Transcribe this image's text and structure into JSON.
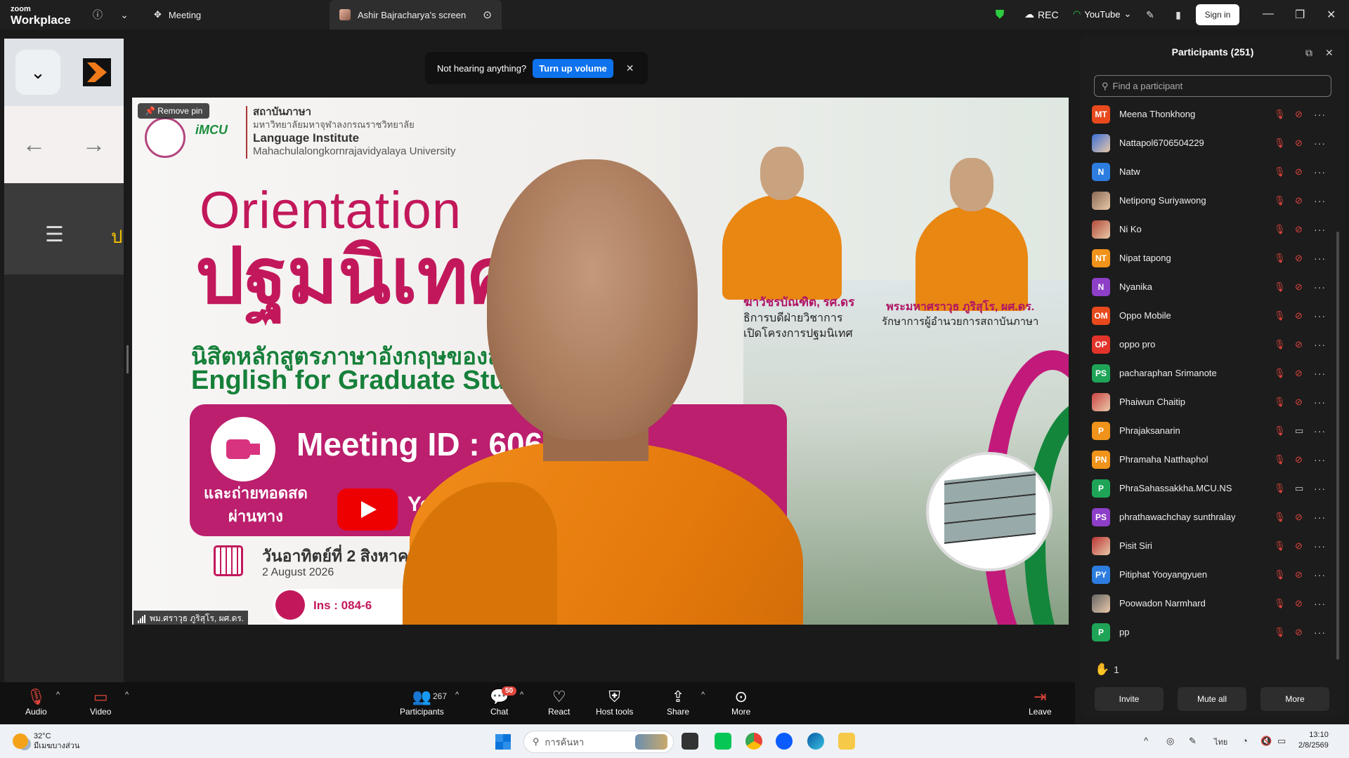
{
  "app": {
    "brand_small": "zoom",
    "brand_big": "Workplace"
  },
  "tabs": [
    {
      "label": "Meeting"
    },
    {
      "label": "Ashir Bajracharya's screen"
    }
  ],
  "titlebar": {
    "rec": "REC",
    "youtube": "YouTube",
    "sign_in": "Sign in"
  },
  "notification": {
    "text": "Not hearing anything?",
    "button": "Turn up volume"
  },
  "stage": {
    "remove_pin": "Remove pin",
    "nametag": "พม.ศราวุธ ภูริสุโร, ผศ.ดร.",
    "slide": {
      "inst_th1": "สถาบันภาษา",
      "inst_th2": "มหาวิทยาลัยมหาจุฬาลงกรณราชวิทยาลัย",
      "inst_en1": "Language Institute",
      "inst_en2": "Mahachulalongkornrajavidyalaya University",
      "imcu": "iMCU",
      "orientation": "Orientation",
      "orientation_th": "ปฐมนิเทศ",
      "subtitle_th": "นิสิตหลักสูตรภาษาอังกฤษของสถาบัน",
      "subtitle_en": "English for Graduate Student",
      "meeting_id": "Meeting ID : 606",
      "live_th1": "และถ่ายทอดสด",
      "live_th2": "ผ่านทาง",
      "youtube_text": "Youtube",
      "date_th": "วันอาทิตย์ที่ 2 สิงหาคม",
      "date_en": "2 August 2026",
      "ins": "Ins : 084-6",
      "caption1_name": "ฆาวัชรบัณฑิต, รศ.ดร",
      "caption1_line1": "ธิการบดีฝ่ายวิชาการ",
      "caption1_line2": "เปิดโครงการปฐมนิเทศ",
      "caption2_name": "พระมหาศราวุธ ภูริสุโร, ผศ.ดร.",
      "caption2_line1": "รักษาการผู้อำนวยการสถาบันภาษา"
    }
  },
  "participants_panel": {
    "title": "Participants (251)",
    "search_placeholder": "Find a participant",
    "raised_hands": "1",
    "buttons": {
      "invite": "Invite",
      "mute_all": "Mute all",
      "more": "More"
    },
    "list": [
      {
        "initials": "MT",
        "name": "Meena Thonkhong",
        "color": "#e8491d",
        "video_on": false
      },
      {
        "initials": "",
        "name": "Nattapol6706504229",
        "color": "#3b6fd6",
        "video_on": false,
        "photo": true
      },
      {
        "initials": "N",
        "name": "Natw",
        "color": "#2d7de0",
        "video_on": false
      },
      {
        "initials": "",
        "name": "Netipong Suriyawong",
        "color": "#8b6a55",
        "video_on": false,
        "photo": true
      },
      {
        "initials": "",
        "name": "Ni Ko",
        "color": "#b34b3a",
        "video_on": false,
        "photo": true
      },
      {
        "initials": "NT",
        "name": "Nipat tapong",
        "color": "#f0931a",
        "video_on": false
      },
      {
        "initials": "N",
        "name": "Nyanika",
        "color": "#8e3fc8",
        "video_on": false
      },
      {
        "initials": "OM",
        "name": "Oppo Mobile",
        "color": "#e8491d",
        "video_on": false
      },
      {
        "initials": "OP",
        "name": "oppo pro",
        "color": "#e2342a",
        "video_on": false
      },
      {
        "initials": "PS",
        "name": "pacharaphan Srimanote",
        "color": "#1fa457",
        "video_on": false
      },
      {
        "initials": "",
        "name": "Phaiwun Chaitip",
        "color": "#c44",
        "video_on": false,
        "photo": true
      },
      {
        "initials": "P",
        "name": "Phrajaksanarin",
        "color": "#f0931a",
        "video_on": true
      },
      {
        "initials": "PN",
        "name": "Phramaha Natthaphol",
        "color": "#f0931a",
        "video_on": false
      },
      {
        "initials": "P",
        "name": "PhraSahassakkha.MCU.NS",
        "color": "#1fa457",
        "video_on": true
      },
      {
        "initials": "PS",
        "name": "phrathawachchay sunthralay",
        "color": "#8e3fc8",
        "video_on": false
      },
      {
        "initials": "",
        "name": "Pisit Siri",
        "color": "#b33",
        "video_on": false,
        "photo": true
      },
      {
        "initials": "PY",
        "name": "Pitiphat Yooyangyuen",
        "color": "#2d7de0",
        "video_on": false
      },
      {
        "initials": "",
        "name": "Poowadon Narmhard",
        "color": "#666",
        "video_on": false,
        "photo": true
      },
      {
        "initials": "P",
        "name": "pp",
        "color": "#1fa457",
        "video_on": false
      }
    ]
  },
  "toolbar": {
    "audio": "Audio",
    "video": "Video",
    "participants": "Participants",
    "participants_count": "267",
    "chat": "Chat",
    "chat_badge": "50",
    "react": "React",
    "host_tools": "Host tools",
    "share": "Share",
    "more": "More",
    "leave": "Leave"
  },
  "taskbar": {
    "temp": "32°C",
    "weather_desc": "มีเมฆบางส่วน",
    "search_placeholder": "การค้นหา",
    "lang": "ไทย",
    "time": "13:10",
    "date": "2/8/2569"
  }
}
